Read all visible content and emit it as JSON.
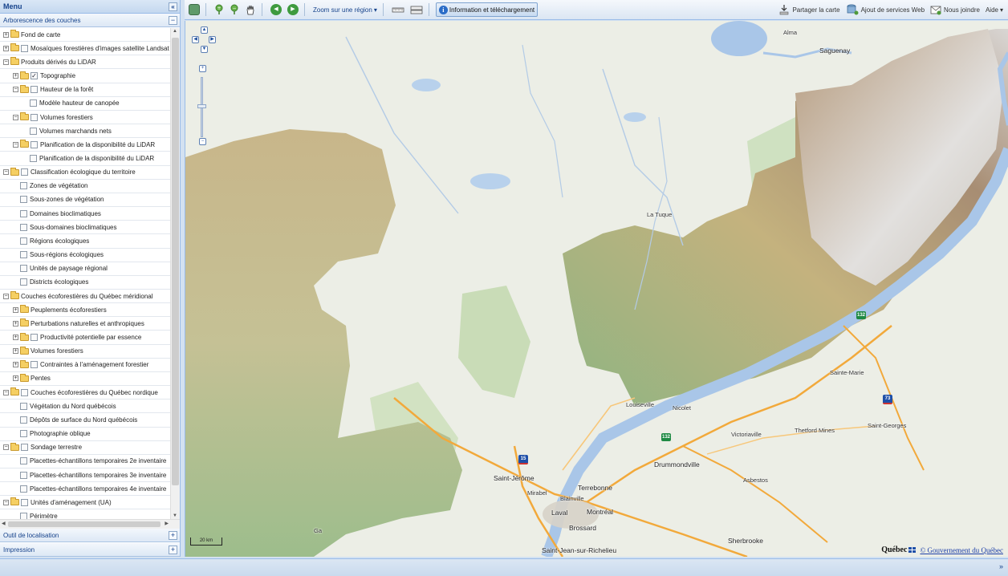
{
  "menu": {
    "title": "Menu",
    "collapse_label": "«"
  },
  "layer_tree": {
    "title": "Arborescence des couches",
    "rows": [
      {
        "label": "Fond de carte",
        "indent": 0,
        "expander": "+",
        "folder": true,
        "checkbox": false
      },
      {
        "label": "Mosaïques forestières d'images satellite Landsat",
        "indent": 0,
        "expander": "+",
        "folder": true,
        "checkbox": true,
        "checked": false
      },
      {
        "label": "Produits dérivés du LiDAR",
        "indent": 0,
        "expander": "−",
        "folder": true,
        "checkbox": false
      },
      {
        "label": "Topographie",
        "indent": 1,
        "expander": "+",
        "folder": true,
        "checkbox": true,
        "checked": true
      },
      {
        "label": "Hauteur de la forêt",
        "indent": 1,
        "expander": "−",
        "folder": true,
        "checkbox": true,
        "checked": false
      },
      {
        "label": "Modèle hauteur de canopée",
        "indent": 2,
        "expander": "",
        "folder": false,
        "checkbox": true,
        "checked": false
      },
      {
        "label": "Volumes forestiers",
        "indent": 1,
        "expander": "−",
        "folder": true,
        "checkbox": true,
        "checked": false
      },
      {
        "label": "Volumes marchands nets",
        "indent": 2,
        "expander": "",
        "folder": false,
        "checkbox": true,
        "checked": false
      },
      {
        "label": "Planification de la disponibilité du LiDAR",
        "indent": 1,
        "expander": "−",
        "folder": true,
        "checkbox": true,
        "checked": false
      },
      {
        "label": "Planification de la disponibilité du LiDAR",
        "indent": 2,
        "expander": "",
        "folder": false,
        "checkbox": true,
        "checked": false
      },
      {
        "label": "Classification écologique du territoire",
        "indent": 0,
        "expander": "−",
        "folder": true,
        "checkbox": true,
        "checked": false
      },
      {
        "label": "Zones de végétation",
        "indent": 1,
        "expander": "",
        "folder": false,
        "checkbox": true,
        "checked": false
      },
      {
        "label": "Sous-zones de végétation",
        "indent": 1,
        "expander": "",
        "folder": false,
        "checkbox": true,
        "checked": false
      },
      {
        "label": "Domaines bioclimatiques",
        "indent": 1,
        "expander": "",
        "folder": false,
        "checkbox": true,
        "checked": false
      },
      {
        "label": "Sous-domaines bioclimatiques",
        "indent": 1,
        "expander": "",
        "folder": false,
        "checkbox": true,
        "checked": false
      },
      {
        "label": "Régions écologiques",
        "indent": 1,
        "expander": "",
        "folder": false,
        "checkbox": true,
        "checked": false
      },
      {
        "label": "Sous-régions écologiques",
        "indent": 1,
        "expander": "",
        "folder": false,
        "checkbox": true,
        "checked": false
      },
      {
        "label": "Unités de paysage régional",
        "indent": 1,
        "expander": "",
        "folder": false,
        "checkbox": true,
        "checked": false
      },
      {
        "label": "Districts écologiques",
        "indent": 1,
        "expander": "",
        "folder": false,
        "checkbox": true,
        "checked": false
      },
      {
        "label": "Couches écoforestières du Québec méridional",
        "indent": 0,
        "expander": "−",
        "folder": true,
        "checkbox": false
      },
      {
        "label": "Peuplements écoforestiers",
        "indent": 1,
        "expander": "+",
        "folder": true,
        "checkbox": false
      },
      {
        "label": "Perturbations naturelles et anthropiques",
        "indent": 1,
        "expander": "+",
        "folder": true,
        "checkbox": false
      },
      {
        "label": "Productivité potentielle par essence",
        "indent": 1,
        "expander": "+",
        "folder": true,
        "checkbox": true,
        "checked": false
      },
      {
        "label": "Volumes forestiers",
        "indent": 1,
        "expander": "+",
        "folder": true,
        "checkbox": false
      },
      {
        "label": "Contraintes à l'aménagement forestier",
        "indent": 1,
        "expander": "+",
        "folder": true,
        "checkbox": true,
        "checked": false
      },
      {
        "label": "Pentes",
        "indent": 1,
        "expander": "+",
        "folder": true,
        "checkbox": false
      },
      {
        "label": "Couches écoforestières du Québec nordique",
        "indent": 0,
        "expander": "−",
        "folder": true,
        "checkbox": true,
        "checked": false
      },
      {
        "label": "Végétation du Nord québécois",
        "indent": 1,
        "expander": "",
        "folder": false,
        "checkbox": true,
        "checked": false
      },
      {
        "label": "Dépôts de surface du Nord québécois",
        "indent": 1,
        "expander": "",
        "folder": false,
        "checkbox": true,
        "checked": false
      },
      {
        "label": "Photographie oblique",
        "indent": 1,
        "expander": "",
        "folder": false,
        "checkbox": true,
        "checked": false
      },
      {
        "label": "Sondage terrestre",
        "indent": 0,
        "expander": "−",
        "folder": true,
        "checkbox": true,
        "checked": false
      },
      {
        "label": "Placettes-échantillons temporaires 2e inventaire",
        "indent": 1,
        "expander": "",
        "folder": false,
        "checkbox": true,
        "checked": false
      },
      {
        "label": "Placettes-échantillons temporaires 3e inventaire",
        "indent": 1,
        "expander": "",
        "folder": false,
        "checkbox": true,
        "checked": false
      },
      {
        "label": "Placettes-échantillons temporaires 4e inventaire",
        "indent": 1,
        "expander": "",
        "folder": false,
        "checkbox": true,
        "checked": false
      },
      {
        "label": "Unités d'aménagement (UA)",
        "indent": 0,
        "expander": "−",
        "folder": true,
        "checkbox": true,
        "checked": false
      },
      {
        "label": "Périmètre",
        "indent": 1,
        "expander": "",
        "folder": false,
        "checkbox": true,
        "checked": false
      }
    ]
  },
  "accordion": {
    "localisation": "Outil de localisation",
    "impression": "Impression",
    "toggle_symbol": "+",
    "collapse_symbol": "−"
  },
  "toolbar": {
    "zoom_region": "Zoom sur une région",
    "info_download": "Information et téléchargement",
    "share": "Partager la carte",
    "web_services": "Ajout de services Web",
    "contact": "Nous joindre",
    "help": "Aide",
    "info_symbol": "i",
    "back_symbol": "◀",
    "forward_symbol": "▶",
    "dropdown_symbol": "▾"
  },
  "map": {
    "scale_label": "20 km",
    "attribution_logo": "Québec",
    "attribution_link": "© Gouvernement du Québec",
    "nav": {
      "pan_up": "▲",
      "pan_left": "◀",
      "pan_right": "▶",
      "pan_down": "▼",
      "zoom_in": "+",
      "zoom_out": "−"
    },
    "cities": [
      "Alma",
      "Saguenay",
      "La Tuque",
      "Louiseville",
      "Nicolet",
      "Victoriaville",
      "Thetford Mines",
      "Saint-Georges",
      "Sainte-Marie",
      "Drummondville",
      "Saint-Jérôme",
      "Mirabel",
      "Blainville",
      "Terrebonne",
      "Laval",
      "Montréal",
      "Brossard",
      "Asbestos",
      "Sherbrooke",
      "Saint-Jean-sur-Richelieu",
      "Ga"
    ],
    "shields": [
      "132",
      "73",
      "15",
      "132"
    ]
  },
  "colors": {
    "panel_header": "#15428b",
    "border": "#99bbe8",
    "relief_low": "#8fb482",
    "relief_mid": "#c7b98a",
    "relief_high": "#b9a9a0",
    "water": "#a9c6e8",
    "road": "#f2a93b"
  },
  "bottom_bar": {
    "expand_symbol": "»"
  }
}
